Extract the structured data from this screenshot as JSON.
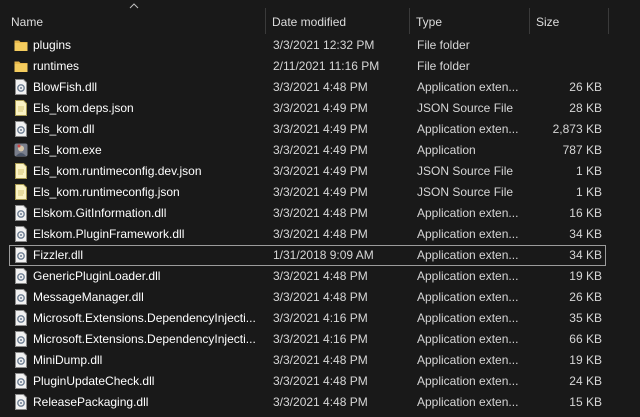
{
  "columns": {
    "name": "Name",
    "date": "Date modified",
    "type": "Type",
    "size": "Size"
  },
  "icons": {
    "folder": "folder-icon",
    "dll": "dll-gear-icon",
    "json": "json-file-icon",
    "exe": "exe-app-icon"
  },
  "colors": {
    "background": "#191919",
    "folder": "#e8b84b",
    "selection_border": "#9b9b9b"
  },
  "files": [
    {
      "name": "plugins",
      "date": "3/3/2021 12:32 PM",
      "type": "File folder",
      "size": "",
      "icon": "folder"
    },
    {
      "name": "runtimes",
      "date": "2/11/2021 11:16 PM",
      "type": "File folder",
      "size": "",
      "icon": "folder"
    },
    {
      "name": "BlowFish.dll",
      "date": "3/3/2021 4:48 PM",
      "type": "Application exten...",
      "size": "26 KB",
      "icon": "dll"
    },
    {
      "name": "Els_kom.deps.json",
      "date": "3/3/2021 4:49 PM",
      "type": "JSON Source File",
      "size": "28 KB",
      "icon": "json"
    },
    {
      "name": "Els_kom.dll",
      "date": "3/3/2021 4:49 PM",
      "type": "Application exten...",
      "size": "2,873 KB",
      "icon": "dll"
    },
    {
      "name": "Els_kom.exe",
      "date": "3/3/2021 4:49 PM",
      "type": "Application",
      "size": "787 KB",
      "icon": "exe"
    },
    {
      "name": "Els_kom.runtimeconfig.dev.json",
      "date": "3/3/2021 4:49 PM",
      "type": "JSON Source File",
      "size": "1 KB",
      "icon": "json"
    },
    {
      "name": "Els_kom.runtimeconfig.json",
      "date": "3/3/2021 4:49 PM",
      "type": "JSON Source File",
      "size": "1 KB",
      "icon": "json"
    },
    {
      "name": "Elskom.GitInformation.dll",
      "date": "3/3/2021 4:48 PM",
      "type": "Application exten...",
      "size": "16 KB",
      "icon": "dll"
    },
    {
      "name": "Elskom.PluginFramework.dll",
      "date": "3/3/2021 4:48 PM",
      "type": "Application exten...",
      "size": "34 KB",
      "icon": "dll"
    },
    {
      "name": "Fizzler.dll",
      "date": "1/31/2018 9:09 AM",
      "type": "Application exten...",
      "size": "34 KB",
      "icon": "dll",
      "selected": true
    },
    {
      "name": "GenericPluginLoader.dll",
      "date": "3/3/2021 4:48 PM",
      "type": "Application exten...",
      "size": "19 KB",
      "icon": "dll"
    },
    {
      "name": "MessageManager.dll",
      "date": "3/3/2021 4:48 PM",
      "type": "Application exten...",
      "size": "26 KB",
      "icon": "dll"
    },
    {
      "name": "Microsoft.Extensions.DependencyInjecti...",
      "date": "3/3/2021 4:16 PM",
      "type": "Application exten...",
      "size": "35 KB",
      "icon": "dll"
    },
    {
      "name": "Microsoft.Extensions.DependencyInjecti...",
      "date": "3/3/2021 4:16 PM",
      "type": "Application exten...",
      "size": "66 KB",
      "icon": "dll"
    },
    {
      "name": "MiniDump.dll",
      "date": "3/3/2021 4:48 PM",
      "type": "Application exten...",
      "size": "19 KB",
      "icon": "dll"
    },
    {
      "name": "PluginUpdateCheck.dll",
      "date": "3/3/2021 4:48 PM",
      "type": "Application exten...",
      "size": "24 KB",
      "icon": "dll"
    },
    {
      "name": "ReleasePackaging.dll",
      "date": "3/3/2021 4:48 PM",
      "type": "Application exten...",
      "size": "15 KB",
      "icon": "dll"
    }
  ]
}
